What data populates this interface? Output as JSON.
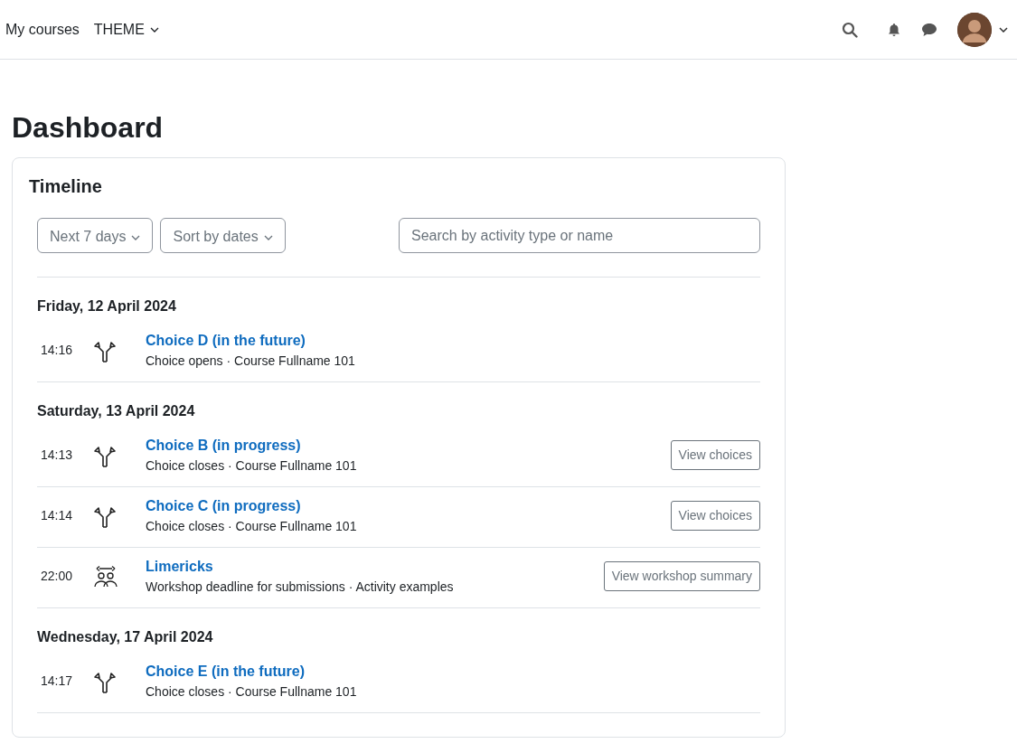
{
  "navbar": {
    "links": [
      {
        "label": "My courses",
        "dropdown": false
      },
      {
        "label": "THEME",
        "dropdown": true
      }
    ]
  },
  "page_title": "Dashboard",
  "timeline": {
    "title": "Timeline",
    "filters": [
      {
        "label": "Next 7 days"
      },
      {
        "label": "Sort by dates"
      }
    ],
    "search": {
      "placeholder": "Search by activity type or name"
    },
    "days": [
      {
        "date": "Friday, 12 April 2024",
        "events": [
          {
            "time": "14:16",
            "kind": "choice",
            "title": "Choice D (in the future)",
            "details": "Choice opens · Course Fullname 101"
          }
        ]
      },
      {
        "date": "Saturday, 13 April 2024",
        "events": [
          {
            "time": "14:13",
            "kind": "choice",
            "title": "Choice B (in progress)",
            "details": "Choice closes · Course Fullname 101",
            "action": "View choices"
          },
          {
            "time": "14:14",
            "kind": "choice",
            "title": "Choice C (in progress)",
            "details": "Choice closes · Course Fullname 101",
            "action": "View choices"
          },
          {
            "time": "22:00",
            "kind": "workshop",
            "title": "Limericks",
            "details": "Workshop deadline for submissions · Activity examples",
            "action": "View workshop summary"
          }
        ]
      },
      {
        "date": "Wednesday, 17 April 2024",
        "events": [
          {
            "time": "14:17",
            "kind": "choice",
            "title": "Choice E (in the future)",
            "details": "Choice closes · Course Fullname 101"
          }
        ]
      }
    ]
  }
}
